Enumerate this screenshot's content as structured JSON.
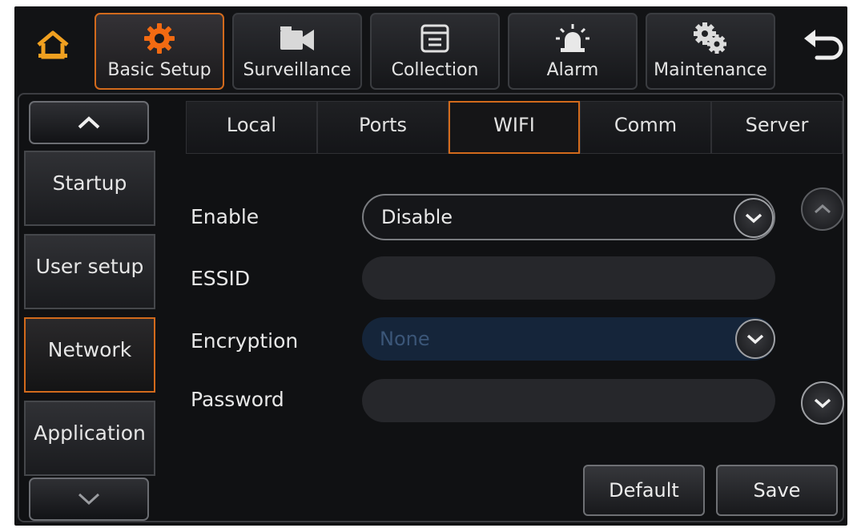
{
  "nav": {
    "items": [
      {
        "label": "Basic Setup",
        "icon": "gear-icon",
        "active": true
      },
      {
        "label": "Surveillance",
        "icon": "camera-icon",
        "active": false
      },
      {
        "label": "Collection",
        "icon": "calendar-icon",
        "active": false
      },
      {
        "label": "Alarm",
        "icon": "alarm-light-icon",
        "active": false
      },
      {
        "label": "Maintenance",
        "icon": "gears-icon",
        "active": false
      }
    ],
    "home_icon": "home-icon",
    "back_icon": "back-arrow-icon"
  },
  "sidebar": {
    "items": [
      {
        "label": "Startup"
      },
      {
        "label": "User setup"
      },
      {
        "label": "Network",
        "active": true
      },
      {
        "label": "Application"
      }
    ]
  },
  "tabs": [
    {
      "label": "Local"
    },
    {
      "label": "Ports"
    },
    {
      "label": "WIFI",
      "active": true
    },
    {
      "label": "Comm"
    },
    {
      "label": "Server"
    }
  ],
  "form": {
    "enable_label": "Enable",
    "enable_value": "Disable",
    "essid_label": "ESSID",
    "essid_value": "",
    "encryption_label": "Encryption",
    "encryption_value": "None",
    "password_label": "Password",
    "password_value": ""
  },
  "buttons": {
    "default_label": "Default",
    "save_label": "Save"
  },
  "colors": {
    "accent": "#d26a1c",
    "home_icon": "#f0a020",
    "gear_icon": "#f26a12",
    "background": "#111214"
  }
}
